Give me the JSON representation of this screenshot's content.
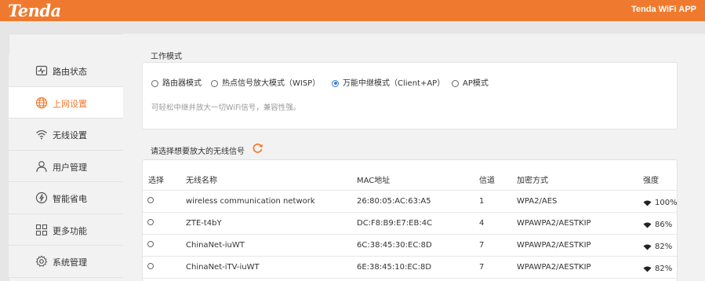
{
  "header": {
    "logo": "Tenda",
    "app_link": "Tenda WiFi APP",
    "brand_color": "#ef7a2f"
  },
  "sidebar": {
    "items": [
      {
        "label": "路由状态",
        "icon": "status-monitor-icon",
        "active": false
      },
      {
        "label": "上网设置",
        "icon": "globe-icon",
        "active": true
      },
      {
        "label": "无线设置",
        "icon": "wifi-icon",
        "active": false
      },
      {
        "label": "用户管理",
        "icon": "user-icon",
        "active": false
      },
      {
        "label": "智能省电",
        "icon": "power-icon",
        "active": false
      },
      {
        "label": "更多功能",
        "icon": "grid-icon",
        "active": false
      },
      {
        "label": "系统管理",
        "icon": "gear-icon",
        "active": false
      }
    ]
  },
  "mode": {
    "title": "工作模式",
    "options": [
      {
        "label": "路由器模式",
        "selected": false
      },
      {
        "label": "热点信号放大模式（WISP）",
        "selected": false
      },
      {
        "label": "万能中继模式（Client+AP）",
        "selected": true
      },
      {
        "label": "AP模式",
        "selected": false
      }
    ],
    "hint": "可轻松中继并放大一切WiFi信号，兼容性强。"
  },
  "scan": {
    "title": "请选择想要放大的无线信号",
    "refresh_icon": "refresh-icon",
    "columns": [
      "选择",
      "无线名称",
      "MAC地址",
      "信道",
      "加密方式",
      "强度"
    ],
    "rows": [
      {
        "ssid": "wireless communication network",
        "mac": "26:80:05:AC:63:A5",
        "channel": "1",
        "security": "WPA2/AES",
        "strength": "100%"
      },
      {
        "ssid": "ZTE-t4bY",
        "mac": "DC:F8:B9:E7:EB:4C",
        "channel": "4",
        "security": "WPAWPA2/AESTKIP",
        "strength": "86%"
      },
      {
        "ssid": "ChinaNet-iuWT",
        "mac": "6C:38:45:30:EC:8D",
        "channel": "7",
        "security": "WPAWPA2/AESTKIP",
        "strength": "82%"
      },
      {
        "ssid": "ChinaNet-iTV-iuWT",
        "mac": "6E:38:45:10:EC:8D",
        "channel": "7",
        "security": "WPAWPA2/AESTKIP",
        "strength": "82%"
      }
    ]
  }
}
